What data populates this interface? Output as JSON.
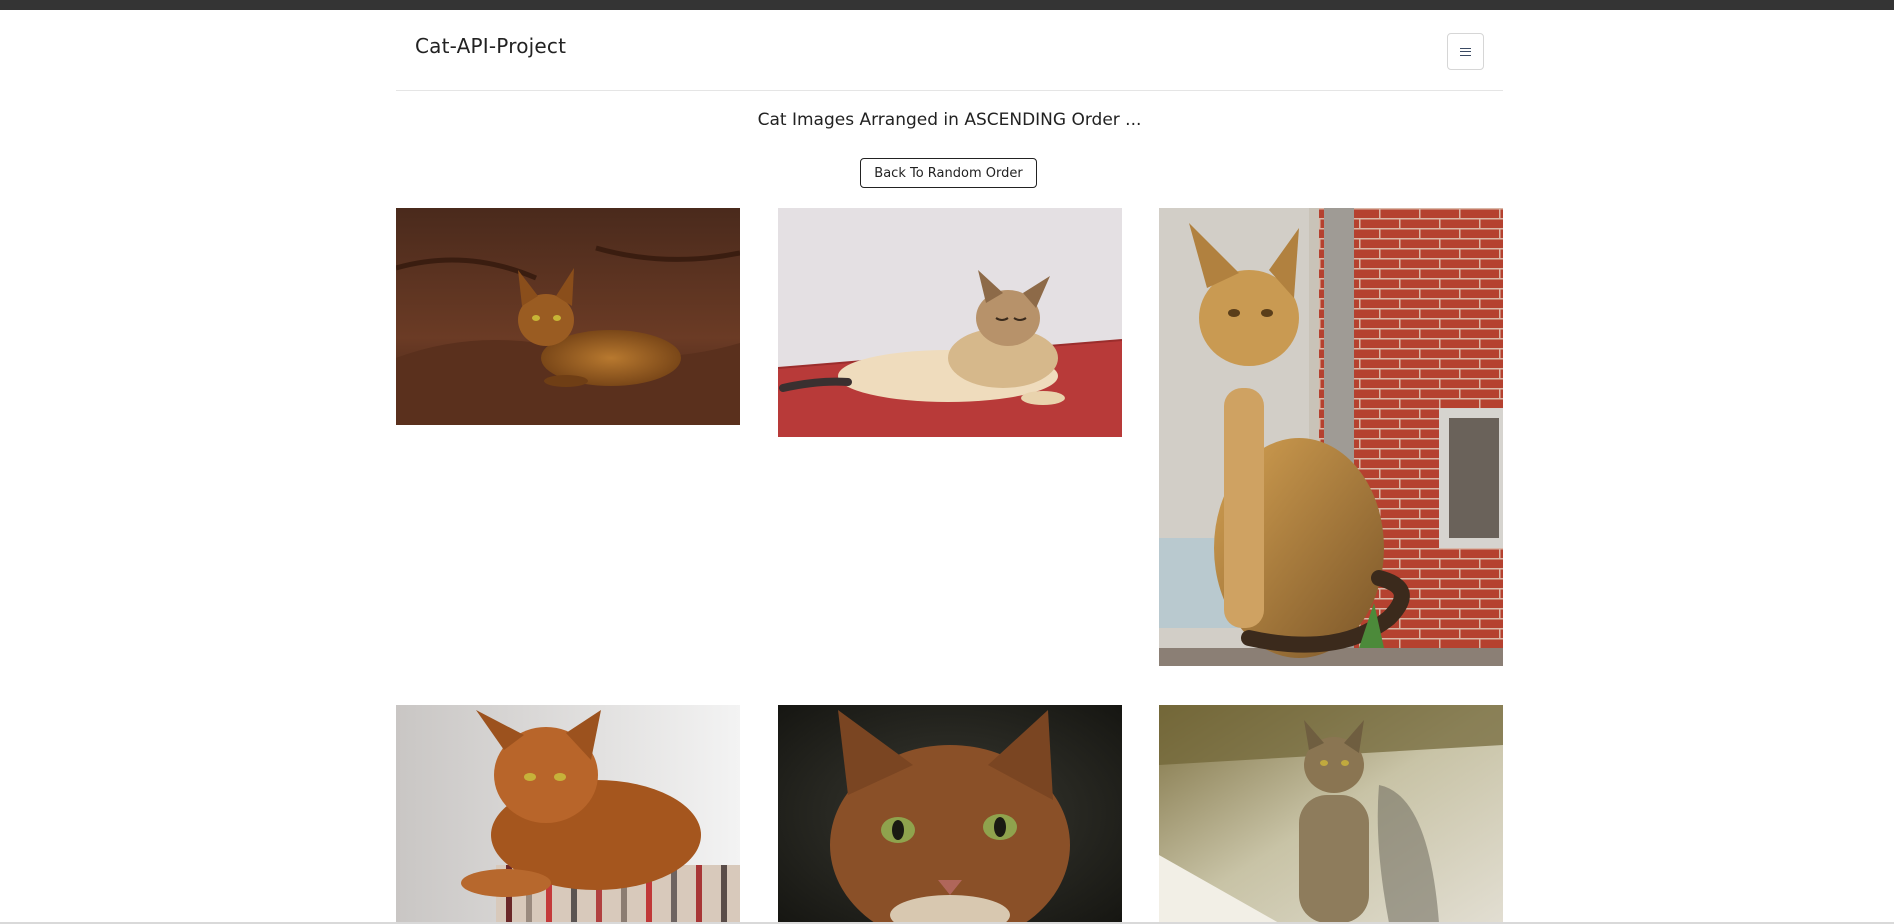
{
  "navbar": {
    "brand": "Cat-API-Project",
    "menu_icon": "hamburger-menu-icon"
  },
  "main": {
    "heading": "Cat Images Arranged in ASCENDING Order ...",
    "order_button_label": "Back To Random Order"
  },
  "gallery": {
    "images": [
      {
        "subject": "abyssinian-cat-on-brown-leather-sofa"
      },
      {
        "subject": "abyssinian-cat-lying-on-red-surface"
      },
      {
        "subject": "abyssinian-cat-sitting-by-brick-wall"
      },
      {
        "subject": "abyssinian-cat-on-striped-cushion"
      },
      {
        "subject": "abyssinian-cat-closeup-dark-background"
      },
      {
        "subject": "abyssinian-cat-sitting-in-sunlight"
      }
    ]
  },
  "colors": {
    "top_strip": "#343434",
    "text": "#222222",
    "divider": "#e5e5e5"
  }
}
